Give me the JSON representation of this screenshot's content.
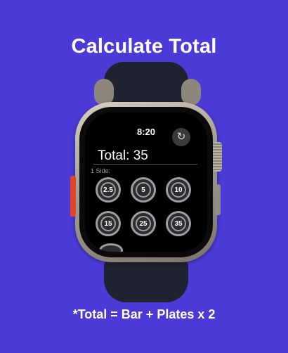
{
  "headline": "Calculate Total",
  "footnote": "*Total = Bar + Plates x 2",
  "watch": {
    "time": "8:20",
    "reset_icon": "↻",
    "total_label": "Total: 35",
    "side_label": "1 Side:",
    "plates": [
      "2.5",
      "5",
      "10",
      "15",
      "25",
      "35"
    ]
  },
  "colors": {
    "background": "#4a3bd6",
    "plate_ring": "#9c9ca2",
    "action_button": "#e0452b"
  }
}
